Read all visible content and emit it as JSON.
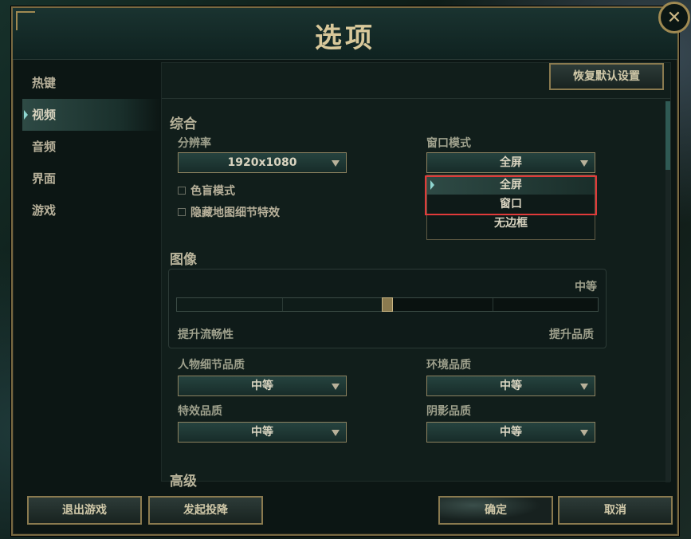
{
  "dialog": {
    "title": "选项",
    "close_glyph": "✕"
  },
  "sidebar": {
    "items": [
      {
        "label": "热键",
        "active": false
      },
      {
        "label": "视频",
        "active": true
      },
      {
        "label": "音频",
        "active": false
      },
      {
        "label": "界面",
        "active": false
      },
      {
        "label": "游戏",
        "active": false
      }
    ]
  },
  "content": {
    "reset_label": "恢复默认设置",
    "general": {
      "title": "综合",
      "resolution_label": "分辨率",
      "resolution_value": "1920x1080",
      "window_mode_label": "窗口模式",
      "window_mode_value": "全屏",
      "window_mode_options": [
        "全屏",
        "窗口",
        "无边框"
      ],
      "colorblind_label": "色盲模式",
      "hide_map_detail_label": "隐藏地图细节特效"
    },
    "graphics": {
      "title": "图像",
      "preset_value": "中等",
      "slider_level": 0.5,
      "slider_left_label": "提升流畅性",
      "slider_right_label": "提升品质"
    },
    "quality": {
      "character_label": "人物细节品质",
      "character_value": "中等",
      "environment_label": "环境品质",
      "environment_value": "中等",
      "effects_label": "特效品质",
      "effects_value": "中等",
      "shadow_label": "阴影品质",
      "shadow_value": "中等"
    },
    "advanced_title": "高级"
  },
  "footer": {
    "exit_label": "退出游戏",
    "surrender_label": "发起投降",
    "ok_label": "确定",
    "cancel_label": "取消"
  },
  "colors": {
    "accent_gold": "#8a7a4f",
    "highlight_red": "#e03a3a",
    "active_teal": "#8fd6d0"
  }
}
